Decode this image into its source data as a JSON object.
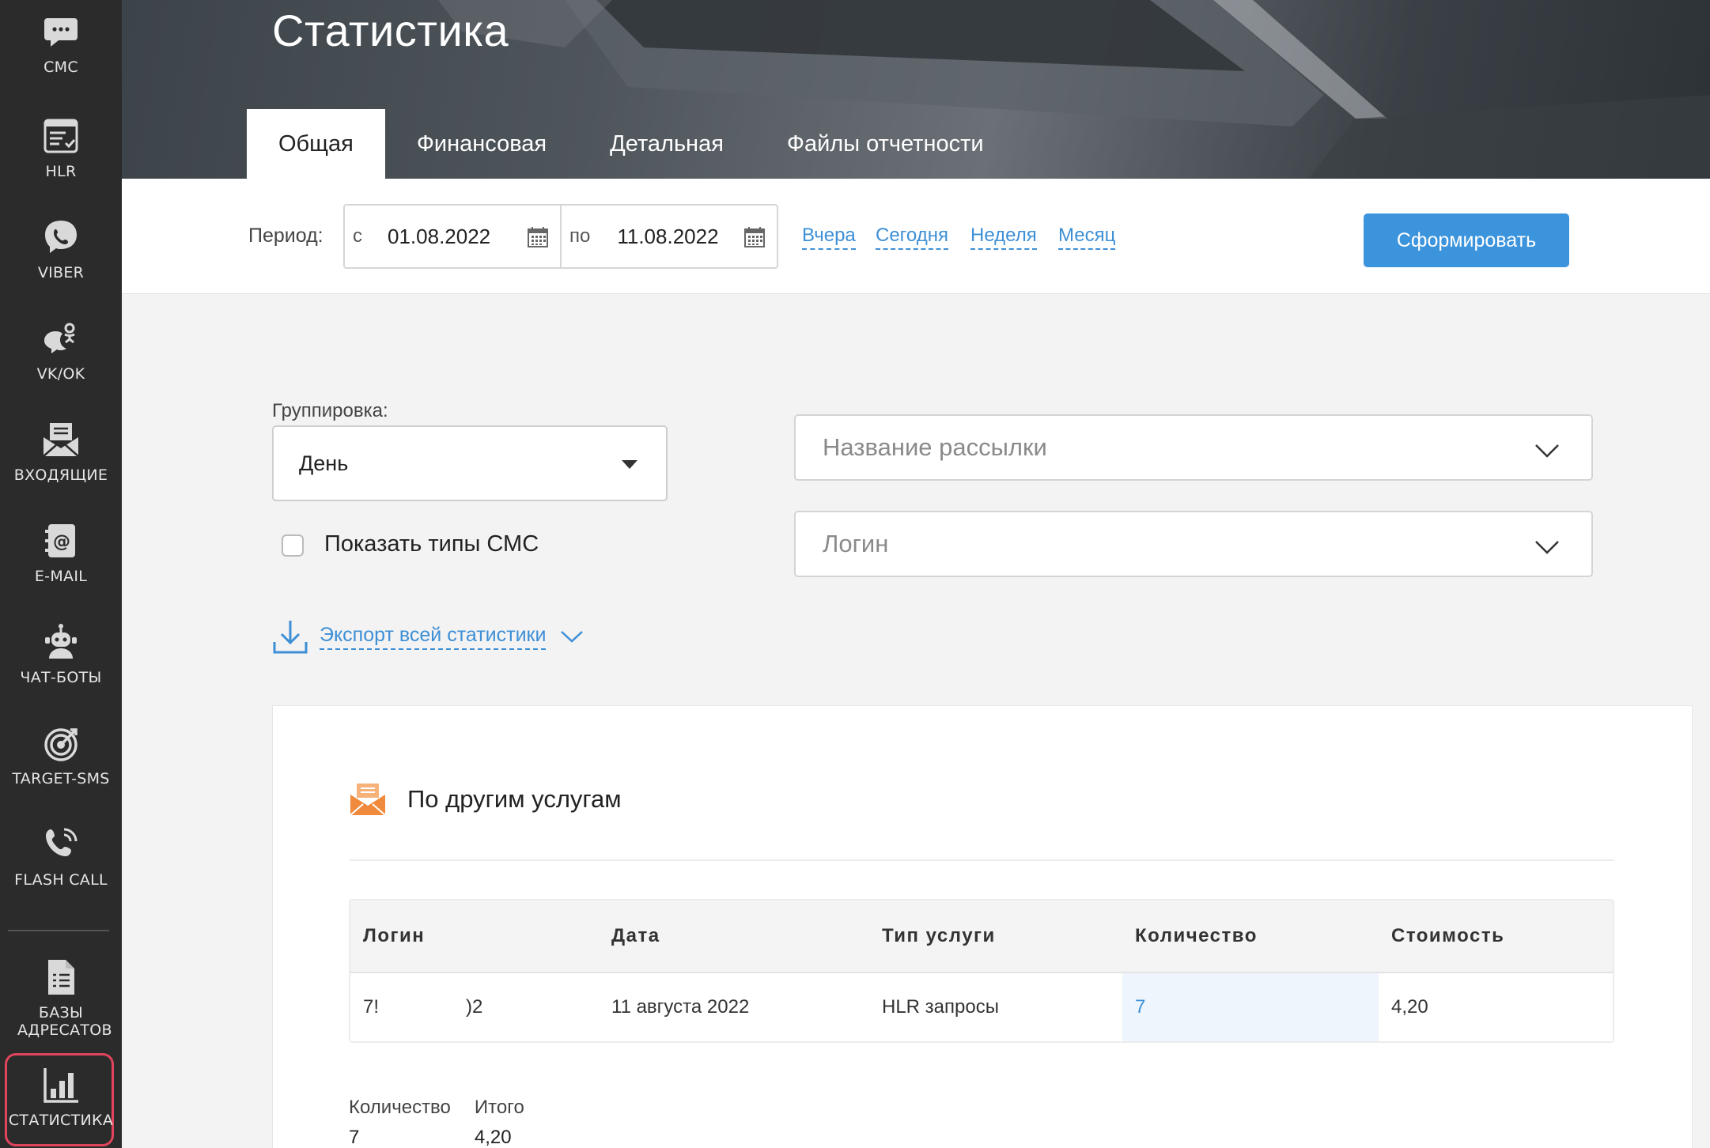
{
  "sidebar": {
    "items": [
      {
        "label": "СМС",
        "icon": "sms-chat-icon"
      },
      {
        "label": "HLR",
        "icon": "hlr-list-icon"
      },
      {
        "label": "VIBER",
        "icon": "viber-icon"
      },
      {
        "label": "VK/OK",
        "icon": "vk-ok-icon"
      },
      {
        "label": "ВХОДЯЩИЕ",
        "icon": "inbox-envelope-icon"
      },
      {
        "label": "E-MAIL",
        "icon": "email-book-icon"
      },
      {
        "label": "ЧАТ-БОТЫ",
        "icon": "chatbot-icon"
      },
      {
        "label": "TARGET-SMS",
        "icon": "target-icon"
      },
      {
        "label": "FLASH CALL",
        "icon": "phone-call-icon"
      },
      {
        "label": "БАЗЫ АДРЕСАТОВ",
        "icon": "document-list-icon"
      },
      {
        "label": "СТАТИСТИКА",
        "icon": "bar-chart-icon"
      }
    ]
  },
  "header": {
    "title": "Статистика",
    "tabs": [
      {
        "label": "Общая"
      },
      {
        "label": "Финансовая"
      },
      {
        "label": "Детальная"
      },
      {
        "label": "Файлы отчетности"
      }
    ]
  },
  "period": {
    "label": "Период:",
    "from_prefix": "с",
    "from_value": "01.08.2022",
    "to_prefix": "по",
    "to_value": "11.08.2022",
    "quick": [
      "Вчера",
      "Сегодня",
      "Неделя",
      "Месяц"
    ],
    "submit_label": "Сформировать"
  },
  "filters": {
    "grouping_label": "Группировка:",
    "grouping_value": "День",
    "show_types_label": "Показать типы СМС",
    "campaign_placeholder": "Название рассылки",
    "login_placeholder": "Логин",
    "export_label": "Экспорт всей статистики"
  },
  "panel": {
    "title": "По другим услугам",
    "columns": [
      "Логин",
      "Дата",
      "Тип услуги",
      "Количество",
      "Стоимость"
    ],
    "rows": [
      {
        "login_start": "7!",
        "login_end": ")2",
        "date": "11 августа 2022",
        "service": "HLR запросы",
        "count": "7",
        "cost": "4,20"
      }
    ],
    "totals": {
      "count_label": "Количество",
      "count_value": "7",
      "total_label": "Итого",
      "total_value": "4,20"
    }
  },
  "colors": {
    "sidebar_bg": "#2b2b2b",
    "accent": "#3c94dc",
    "link": "#3d8fd6",
    "active_outline": "#e0455c",
    "service_icon": "#f08a3c"
  }
}
